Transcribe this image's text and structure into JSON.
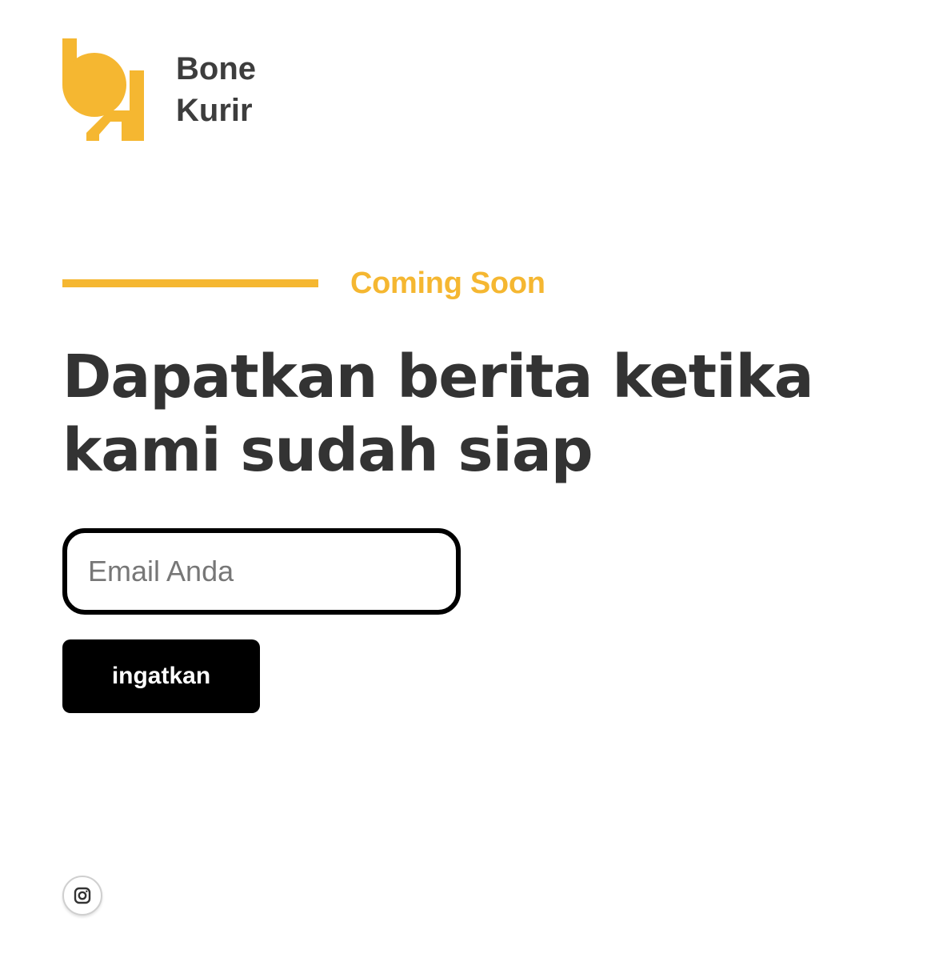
{
  "brand": {
    "name_line1": "Bone",
    "name_line2": "Kurir",
    "logo_icon": "bone-kurir-logo-icon",
    "accent_color": "#f5b731"
  },
  "hero": {
    "kicker": "Coming Soon",
    "headline": "Dapatkan berita ketika kami sudah siap"
  },
  "subscribe_form": {
    "email_placeholder": "Email Anda",
    "email_value": "",
    "submit_label": "ingatkan",
    "button_color": "#000000"
  },
  "social": {
    "icon": "instagram-icon"
  }
}
